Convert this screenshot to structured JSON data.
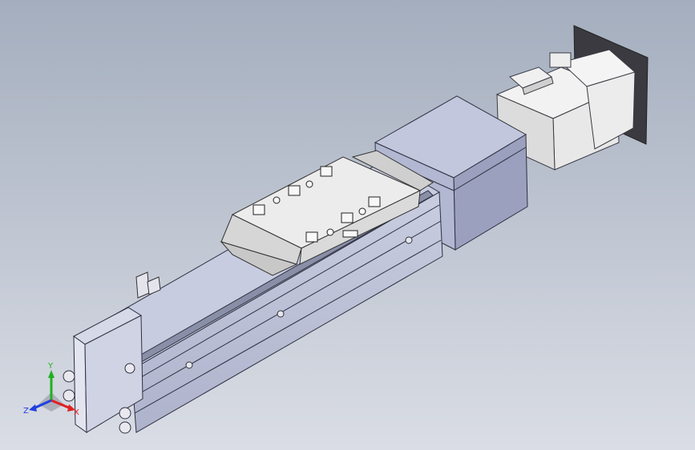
{
  "scene": {
    "background_top": "#a6b0c0",
    "background_bottom": "#d8dce4",
    "model": "linear-actuator-with-servo-motor"
  },
  "triad": {
    "x_label": "X",
    "y_label": "Y",
    "z_label": "Z",
    "x_color": "#e02020",
    "y_color": "#20b020",
    "z_color": "#2040e0"
  }
}
